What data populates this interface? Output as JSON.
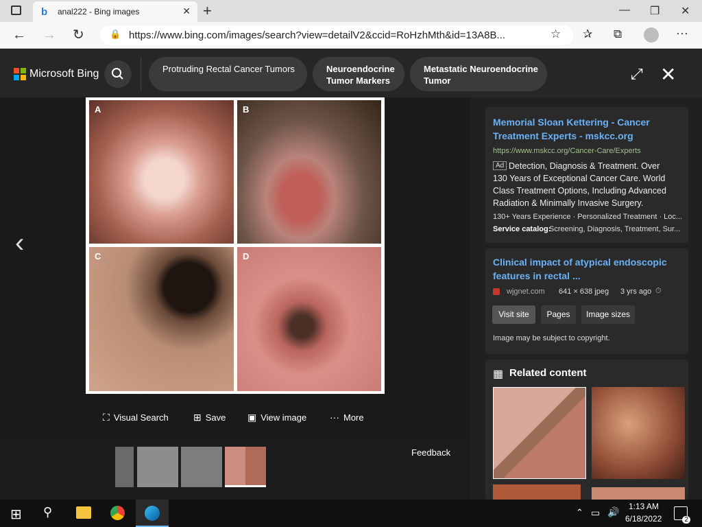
{
  "browser": {
    "tab_title": "anal222 - Bing images",
    "tab_close": "✕",
    "new_tab": "+",
    "url": "https://www.bing.com/images/search?view=detailV2&ccid=RoHzhMth&id=13A8B...",
    "window_controls": {
      "minimize": "—",
      "restore": "❐",
      "close": "✕"
    }
  },
  "bing": {
    "brand": "Microsoft Bing",
    "pills": [
      {
        "label": "Protruding Rectal Cancer Tumors"
      },
      {
        "line1": "Neuroendocrine",
        "line2": "Tumor Markers"
      },
      {
        "line1": "Metastatic Neuroendocrine",
        "line2": "Tumor"
      }
    ]
  },
  "viewer": {
    "panels": [
      "A",
      "B",
      "C",
      "D"
    ],
    "actions": {
      "visual_search": "Visual Search",
      "save": "Save",
      "view_image": "View image",
      "more": "More"
    },
    "feedback": "Feedback"
  },
  "side": {
    "ad": {
      "title_line1": "Memorial Sloan Kettering - Cancer",
      "title_line2": "Treatment Experts - mskcc.org",
      "url": "https://www.mskcc.org/Cancer-Care/Experts",
      "badge": "Ad",
      "desc_line1": "Detection, Diagnosis & Treatment. Over",
      "desc_line2": "130 Years of Exceptional Cancer Care. World",
      "desc_line3": "Class Treatment Options, Including Advanced",
      "desc_line4": "Radiation & Minimally Invasive Surgery.",
      "sitelinks": "130+ Years Experience · Personalized Treatment · Loc...",
      "catalog_label": "Service catalog:",
      "catalog_items": "Screening, Diagnosis, Treatment, Sur..."
    },
    "result": {
      "title_line1": "Clinical impact of atypical endoscopic",
      "title_line2": "features in rectal ...",
      "source": "wjgnet.com",
      "dims": "641 × 638 jpeg",
      "age": "3 yrs ago",
      "visit_site": "Visit site",
      "pages": "Pages",
      "image_sizes": "Image sizes",
      "copyright": "Image may be subject to copyright."
    },
    "related_title": "Related content"
  },
  "taskbar": {
    "time": "1:13 AM",
    "date": "6/18/2022",
    "notifications": "2"
  },
  "colors": {
    "link": "#6ab1f5",
    "ms_red": "#f25022",
    "ms_green": "#7fba00",
    "ms_blue": "#00a4ef",
    "ms_yellow": "#ffb900"
  }
}
